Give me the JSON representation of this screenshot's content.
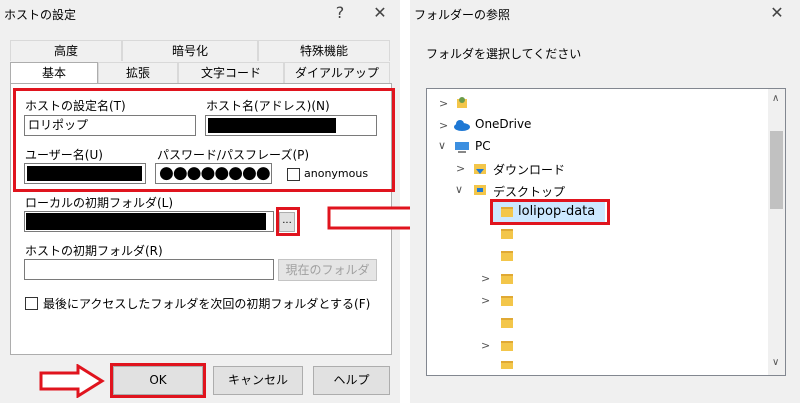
{
  "left_dialog": {
    "title": "ホストの設定",
    "help_button": "?",
    "close_button": "✕",
    "tabs_row1": [
      "高度",
      "暗号化",
      "特殊機能"
    ],
    "tabs_row2": [
      "基本",
      "拡張",
      "文字コード",
      "ダイアルアップ"
    ],
    "host_setting_name_label": "ホストの設定名(T)",
    "host_setting_name_value": "ロリポップ",
    "host_name_label": "ホスト名(アドレス)(N)",
    "username_label": "ユーザー名(U)",
    "password_label": "パスワード/パスフレーズ(P)",
    "password_value": "●●●●●●●●",
    "anonymous_label": "anonymous",
    "local_folder_label": "ローカルの初期フォルダ(L)",
    "browse_button": "...",
    "host_folder_label": "ホストの初期フォルダ(R)",
    "current_folder_button": "現在のフォルダ",
    "last_folder_checkbox_label": "最後にアクセスしたフォルダを次回の初期フォルダとする(F)",
    "ok_button": "OK",
    "cancel_button": "キャンセル",
    "help_btn": "ヘルプ"
  },
  "right_dialog": {
    "title": "フォルダーの参照",
    "close_button": "✕",
    "instruction": "フォルダを選択してください",
    "tree": {
      "onedrive": "OneDrive",
      "pc": "PC",
      "downloads": "ダウンロード",
      "desktop": "デスクトップ",
      "selected": "lolipop-data"
    }
  },
  "colors": {
    "highlight_red": "#e0141e",
    "selection_blue": "#cce8ff",
    "dialog_bg": "#f0f0f0"
  }
}
